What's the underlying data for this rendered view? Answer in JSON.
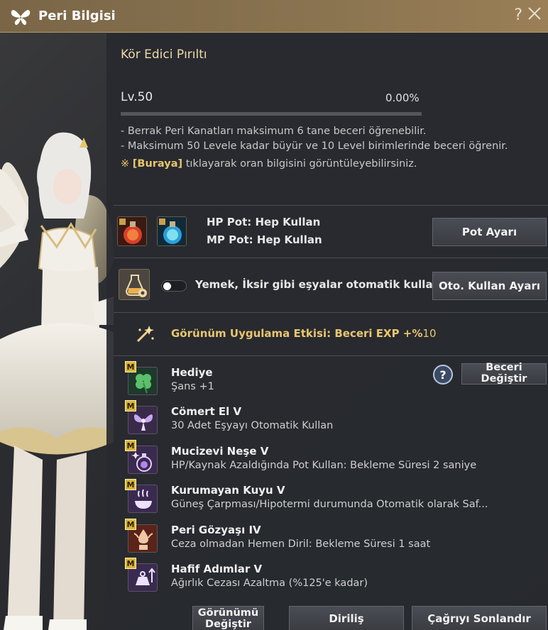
{
  "window": {
    "title": "Peri Bilgisi",
    "help_symbol": "?"
  },
  "peri": {
    "name": "Kör Edici Pırıltı",
    "level": "Lv.50",
    "exp_percent_text": "0.00%",
    "exp_fraction": 0.0
  },
  "notes": {
    "line1": "- Berrak Peri Kanatları maksimum 6 tane beceri öğrenebilir.",
    "line2": "- Maksimum 50 Levele kadar büyür ve 10 Level birimlerinde beceri öğrenir.",
    "line3_prefix": "※ ",
    "line3_link": "[Buraya]",
    "line3_suffix": " tıklayarak oran bilgisini görüntüleyebilirsiniz."
  },
  "potions": {
    "hp_line": "HP Pot: Hep Kullan",
    "mp_line": "MP Pot: Hep Kullan",
    "button": "Pot Ayarı"
  },
  "auto_use": {
    "text": "Yemek, İksir gibi eşyalar otomatik kullanılır.",
    "toggle_on": false,
    "button": "Oto. Kullan Ayarı"
  },
  "appearance_effect": {
    "text": "Görünüm Uygulama Etkisi: Beceri EXP +%",
    "value": "10"
  },
  "skill_section": {
    "help_symbol": "?",
    "change_button": "Beceri Değiştir"
  },
  "skills": [
    {
      "badge": "M",
      "name": "Hediye",
      "desc": "Şans +1",
      "icon": "clover-icon"
    },
    {
      "badge": "M",
      "name": "Cömert El V",
      "desc": "30 Adet Eşyayı Otomatik Kullan",
      "icon": "fairy-icon"
    },
    {
      "badge": "M",
      "name": "Mucizevi Neşe V",
      "desc": "HP/Kaynak Azaldığında Pot Kullan: Bekleme Süresi 2 saniye",
      "icon": "potion-sparkle-icon"
    },
    {
      "badge": "M",
      "name": "Kurumayan Kuyu V",
      "desc": "Güneş Çarpması/Hipotermi durumunda Otomatik olarak Saf...",
      "icon": "bowl-steam-icon"
    },
    {
      "badge": "M",
      "name": "Peri Gözyaşı IV",
      "desc": "Ceza olmadan Hemen Diril: Bekleme Süresi 1 saat",
      "icon": "tear-bottle-icon"
    },
    {
      "badge": "M",
      "name": "Hafif Adımlar V",
      "desc": "Ağırlık Cezası Azaltma (%125'e kadar)",
      "icon": "weight-up-icon"
    }
  ],
  "footer": {
    "appearance_button": "Görünümü Değiştir",
    "revive_button": "Diriliş",
    "dismiss_button": "Çağrıyı Sonlandır"
  },
  "colors": {
    "accent_gold": "#e9c66d",
    "title_bar": "#8a7450",
    "panel": "#2a2c31"
  }
}
